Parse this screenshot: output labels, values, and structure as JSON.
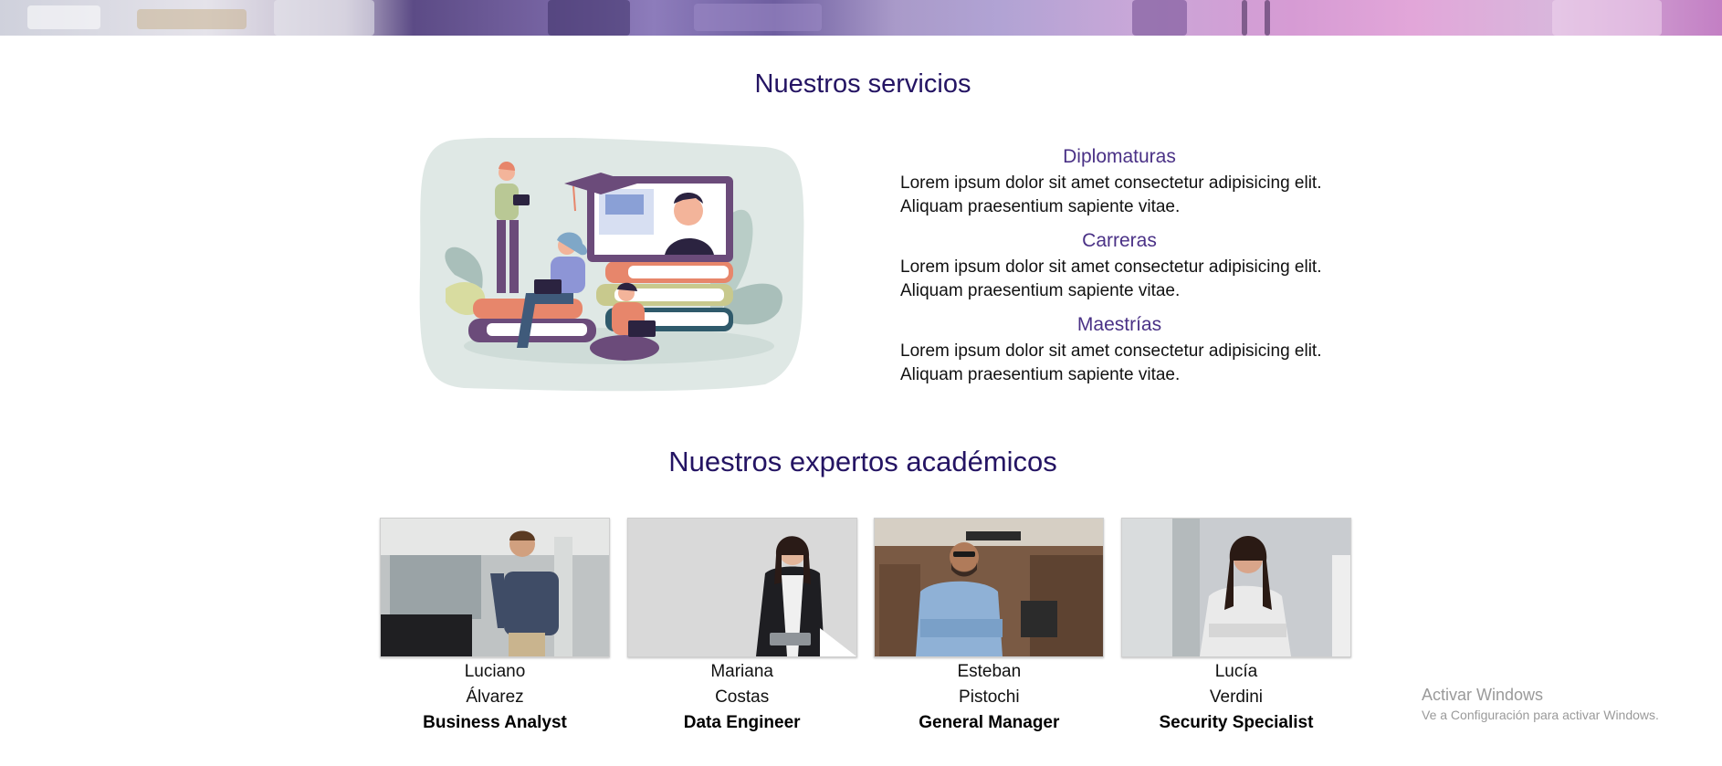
{
  "services": {
    "title": "Nuestros servicios",
    "items": [
      {
        "heading": "Diplomaturas",
        "text": "Lorem ipsum dolor sit amet consectetur adipisicing elit. Aliquam praesentium sapiente vitae."
      },
      {
        "heading": "Carreras",
        "text": "Lorem ipsum dolor sit amet consectetur adipisicing elit. Aliquam praesentium sapiente vitae."
      },
      {
        "heading": "Maestrías",
        "text": "Lorem ipsum dolor sit amet consectetur adipisicing elit. Aliquam praesentium sapiente vitae."
      }
    ]
  },
  "experts": {
    "title": "Nuestros expertos académicos",
    "people": [
      {
        "first": "Luciano",
        "last": "Álvarez",
        "role": "Business Analyst"
      },
      {
        "first": "Mariana",
        "last": "Costas",
        "role": "Data Engineer"
      },
      {
        "first": "Esteban",
        "last": "Pistochi",
        "role": "General Manager"
      },
      {
        "first": "Lucía",
        "last": "Verdini",
        "role": "Security Specialist"
      }
    ]
  },
  "watermark": {
    "title": "Activar Windows",
    "subtitle": "Ve a Configuración para activar Windows."
  },
  "colors": {
    "heading": "#241463",
    "subheading": "#4a3186",
    "illustration_bg": "#dfe8e5"
  }
}
